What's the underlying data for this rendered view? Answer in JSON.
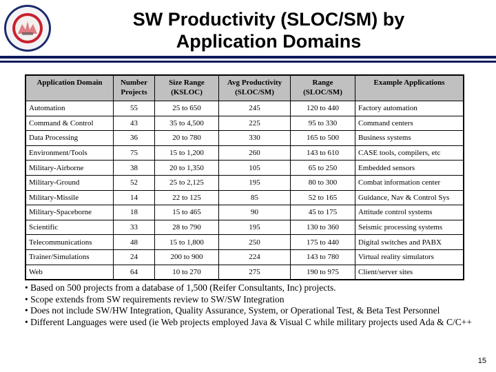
{
  "header": {
    "title_line1": "SW Productivity (SLOC/SM) by",
    "title_line2": "Application Domains",
    "logo": "army-seal-logo"
  },
  "colors": {
    "rule": "#0d1a5c",
    "header_bg": "#c0c0c0",
    "seal_red": "#c8202e",
    "seal_blue": "#1c2a6e"
  },
  "table": {
    "columns": [
      "Application Domain",
      "Number Projects",
      "Size Range (KSLOC)",
      "Avg Productivity (SLOC/SM)",
      "Range (SLOC/SM)",
      "Example Applications"
    ],
    "rows": [
      [
        "Automation",
        "55",
        "25 to 650",
        "245",
        "120 to 440",
        "Factory automation"
      ],
      [
        "Command & Control",
        "43",
        "35 to 4,500",
        "225",
        "95 to 330",
        "Command centers"
      ],
      [
        "Data Processing",
        "36",
        "20 to 780",
        "330",
        "165 to 500",
        "Business systems"
      ],
      [
        "Environment/Tools",
        "75",
        "15 to 1,200",
        "260",
        "143 to 610",
        "CASE tools, compilers, etc"
      ],
      [
        "Military-Airborne",
        "38",
        "20 to 1,350",
        "105",
        "65 to 250",
        "Embedded sensors"
      ],
      [
        "Military-Ground",
        "52",
        "25 to 2,125",
        "195",
        "80 to 300",
        "Combat information center"
      ],
      [
        "Military-Missile",
        "14",
        "22 to 125",
        "85",
        "52 to 165",
        "Guidance, Nav & Control Sys"
      ],
      [
        "Military-Spaceborne",
        "18",
        "15 to 465",
        "90",
        "45 to 175",
        "Attitude control systems"
      ],
      [
        "Scientific",
        "33",
        "28 to 790",
        "195",
        "130 to 360",
        "Seismic processing systems"
      ],
      [
        "Telecommunications",
        "48",
        "15 to 1,800",
        "250",
        "175 to 440",
        "Digital switches and PABX"
      ],
      [
        "Trainer/Simulations",
        "24",
        "200 to 900",
        "224",
        "143 to 780",
        "Virtual reality simulators"
      ],
      [
        "Web",
        "64",
        "10 to 270",
        "275",
        "190 to 975",
        "Client/server sites"
      ]
    ]
  },
  "notes": [
    "• Based on 500 projects from a database of 1,500 (Reifer Consultants, Inc) projects.",
    "• Scope extends from SW requirements review to SW/SW Integration",
    "• Does not include SW/HW Integration, Quality Assurance, System, or Operational Test, & Beta Test Personnel",
    "• Different Languages were used (ie  Web projects employed Java & Visual C while military projects used Ada & C/C++"
  ],
  "page_number": "15"
}
